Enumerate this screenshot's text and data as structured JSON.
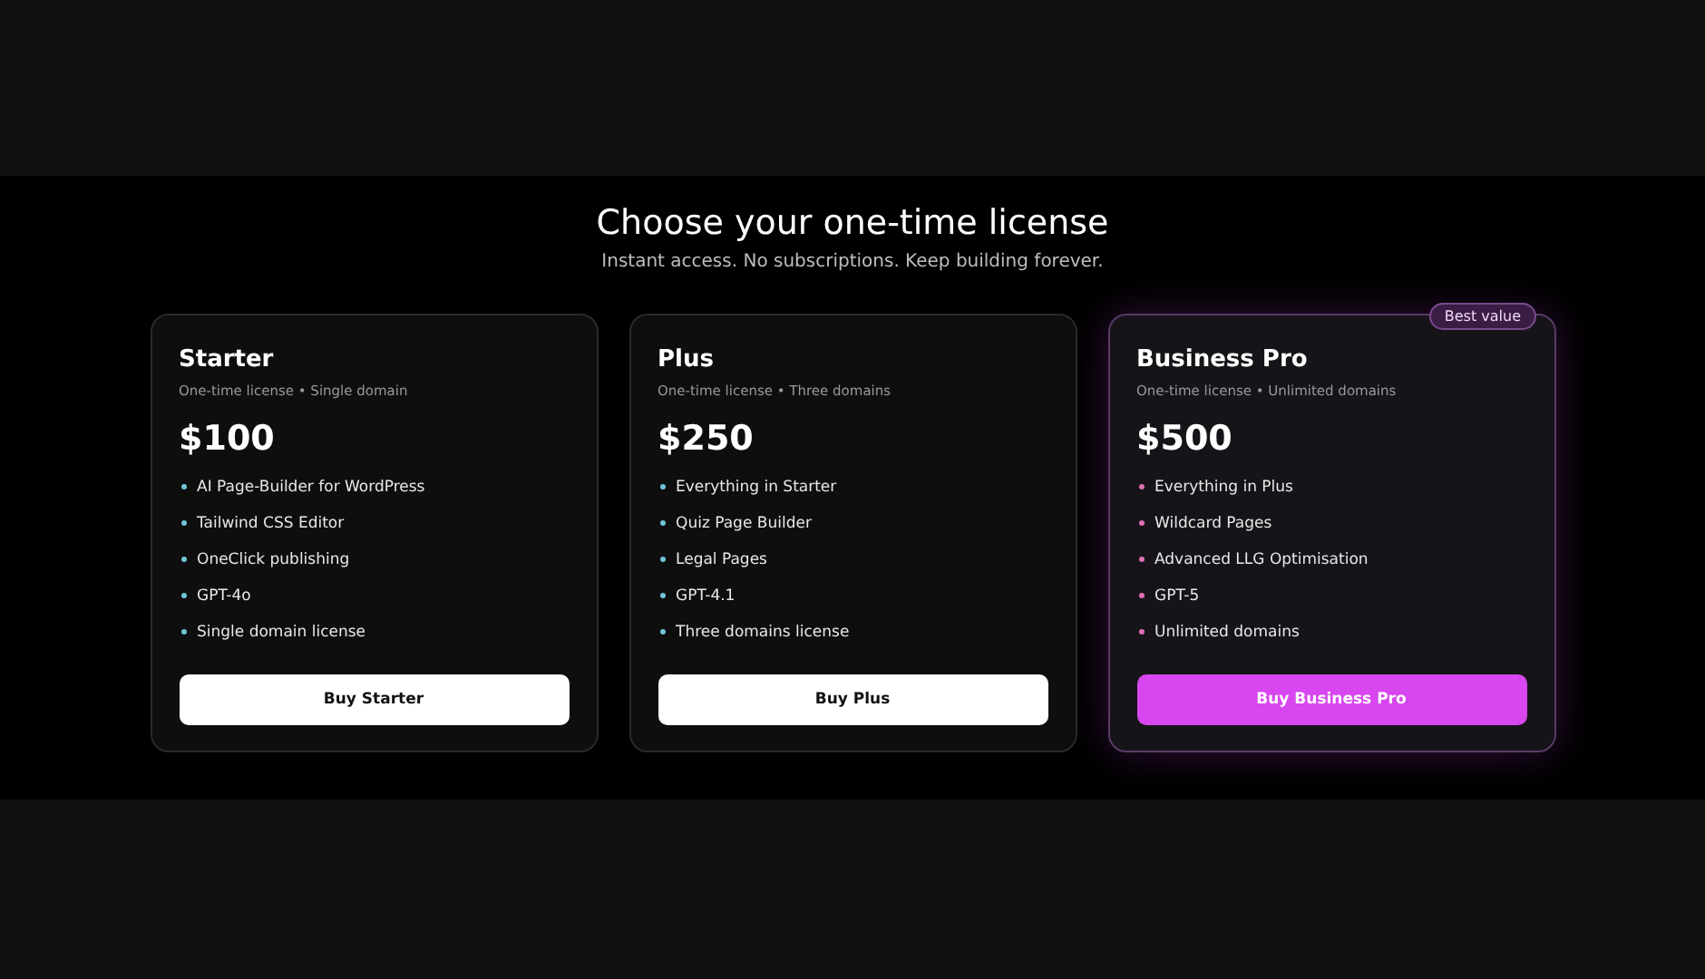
{
  "heading": "Choose your one-time license",
  "subheading": "Instant access. No subscriptions. Keep building forever.",
  "plans": [
    {
      "name": "Starter",
      "subtitle": "One-time license • Single domain",
      "price": "$100",
      "featured": false,
      "features": [
        "AI Page-Builder for WordPress",
        "Tailwind CSS Editor",
        "OneClick publishing",
        "GPT-4o",
        "Single domain license"
      ],
      "button": "Buy Starter"
    },
    {
      "name": "Plus",
      "subtitle": "One-time license • Three domains",
      "price": "$250",
      "featured": false,
      "features": [
        "Everything in Starter",
        "Quiz Page Builder",
        "Legal Pages",
        "GPT-4.1",
        "Three domains license"
      ],
      "button": "Buy Plus"
    },
    {
      "name": "Business Pro",
      "subtitle": "One-time license • Unlimited domains",
      "price": "$500",
      "featured": true,
      "badge": "Best value",
      "features": [
        "Everything in Plus",
        "Wildcard Pages",
        "Advanced LLG Optimisation",
        "GPT-5",
        "Unlimited domains"
      ],
      "button": "Buy Business Pro"
    }
  ]
}
